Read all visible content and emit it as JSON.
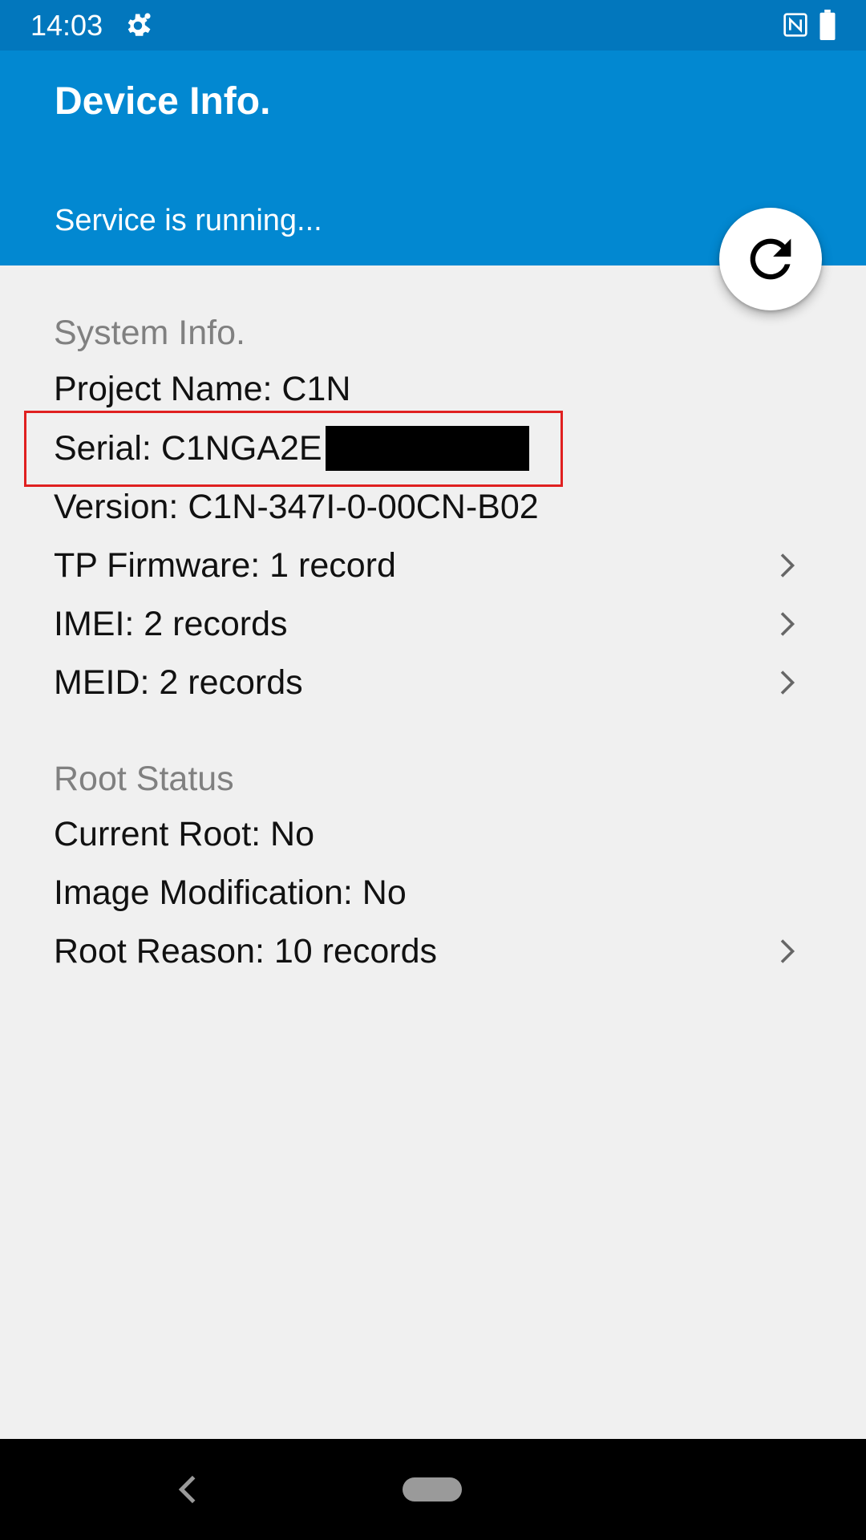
{
  "status_bar": {
    "time": "14:03",
    "icons": [
      "settings-gear-icon",
      "nfc-icon",
      "battery-icon"
    ]
  },
  "app_bar": {
    "title": "Device Info.",
    "subtitle": "Service is running..."
  },
  "fab": {
    "icon": "refresh-icon"
  },
  "sections": {
    "system": {
      "header": "System Info.",
      "project_name": "Project Name: C1N",
      "serial": "Serial: C1NGA2E",
      "version": "Version: C1N-347I-0-00CN-B02",
      "tp_firmware": "TP Firmware: 1 record",
      "imei": "IMEI: 2 records",
      "meid": "MEID: 2 records"
    },
    "root": {
      "header": "Root Status",
      "current_root": "Current Root: No",
      "image_modification": "Image Modification: No",
      "root_reason": "Root Reason: 10 records"
    }
  },
  "colors": {
    "status_bar": "#0277bd",
    "app_bar": "#0288d1",
    "background": "#f0f0f0",
    "highlight": "#e02020",
    "section_header": "#808080"
  }
}
